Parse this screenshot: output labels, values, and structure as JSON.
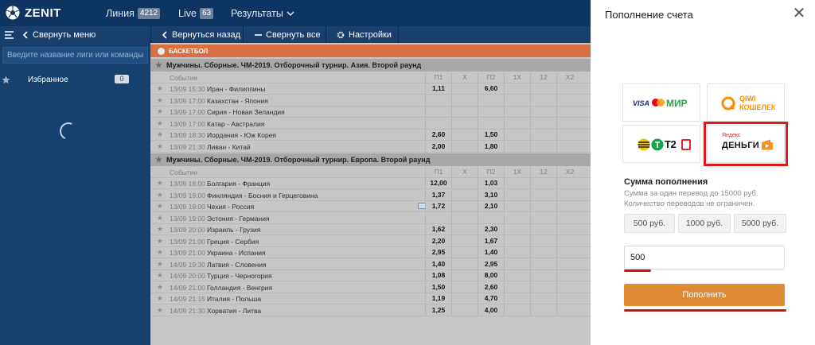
{
  "header": {
    "brand": "ZENIT",
    "nav": [
      {
        "label": "Линия",
        "badge": "4212"
      },
      {
        "label": "Live",
        "badge": "63"
      },
      {
        "label": "Результаты"
      }
    ]
  },
  "subbar": {
    "collapse_menu": "Свернуть меню",
    "back": "Вернуться назад",
    "collapse_all": "Свернуть все",
    "settings": "Настройки"
  },
  "sidebar": {
    "search_placeholder": "Введите название лиги или команды",
    "favorites_label": "Избранное",
    "favorites_count": "0"
  },
  "content": {
    "sport": "БАСКЕТБОЛ",
    "columns": [
      "Событие",
      "П1",
      "X",
      "П2",
      "1X",
      "12",
      "X2"
    ],
    "leagues": [
      {
        "title": "Мужчины. Сборные. ЧМ-2019. Отборочный турнир. Азия. Второй раунд",
        "events": [
          {
            "time": "13/09 15:30",
            "name": "Иран - Филиппины",
            "p1": "1,11",
            "p2": "6,60"
          },
          {
            "time": "13/09 17:00",
            "name": "Казахстан - Япония",
            "p1": "",
            "p2": ""
          },
          {
            "time": "13/09 17:00",
            "name": "Сирия - Новая Зеландия",
            "p1": "",
            "p2": ""
          },
          {
            "time": "13/09 17:00",
            "name": "Катар - Австралия",
            "p1": "",
            "p2": ""
          },
          {
            "time": "13/09 18:30",
            "name": "Иордания - Юж Корея",
            "p1": "2,60",
            "p2": "1,50"
          },
          {
            "time": "13/09 21:30",
            "name": "Ливан - Китай",
            "p1": "2,00",
            "p2": "1,80"
          }
        ]
      },
      {
        "title": "Мужчины. Сборные. ЧМ-2019. Отборочный турнир. Европа. Второй раунд",
        "events": [
          {
            "time": "13/09 18:00",
            "name": "Болгария - Франция",
            "p1": "12,00",
            "p2": "1,03"
          },
          {
            "time": "13/09 19:00",
            "name": "Финляндия - Босния и Герцеговина",
            "p1": "1,37",
            "p2": "3,10"
          },
          {
            "time": "13/09 19:00",
            "name": "Чехия - Россия",
            "p1": "1,72",
            "p2": "2,10"
          },
          {
            "time": "13/09 19:00",
            "name": "Эстония - Германия",
            "p1": "",
            "p2": ""
          },
          {
            "time": "13/09 20:00",
            "name": "Израиль - Грузия",
            "p1": "1,62",
            "p2": "2,30"
          },
          {
            "time": "13/09 21:00",
            "name": "Греция - Сербия",
            "p1": "2,20",
            "p2": "1,67"
          },
          {
            "time": "13/09 21:00",
            "name": "Украина - Испания",
            "p1": "2,95",
            "p2": "1,40"
          },
          {
            "time": "14/09 19:30",
            "name": "Латвия - Словения",
            "p1": "1,40",
            "p2": "2,95"
          },
          {
            "time": "14/09 20:00",
            "name": "Турция - Черногория",
            "p1": "1,08",
            "p2": "8,00"
          },
          {
            "time": "14/09 21:00",
            "name": "Голландия - Венгрия",
            "p1": "1,50",
            "p2": "2,60"
          },
          {
            "time": "14/09 21:15",
            "name": "Италия - Польша",
            "p1": "1,19",
            "p2": "4,70"
          },
          {
            "time": "14/09 21:30",
            "name": "Хорватия - Литва",
            "p1": "1,25",
            "p2": "4,00"
          }
        ]
      }
    ]
  },
  "deposit": {
    "title": "Пополнение счета",
    "payment_methods": [
      {
        "id": "cards",
        "text": "VISA · MasterCard · МИР"
      },
      {
        "id": "qiwi",
        "text": "QIWI КОШЕЛЕК",
        "line1": "QIWI",
        "line2": "КОШЕЛЕК"
      },
      {
        "id": "beeline-tele2",
        "text": "Билайн · Tele2",
        "brand": "T2"
      },
      {
        "id": "yandex",
        "text": "Яндекс Деньги",
        "line1": "Яндекс",
        "line2": "ДЕНЬГИ"
      }
    ],
    "amount_title": "Сумма пополнения",
    "amount_desc_1": "Сумма за один перевод до 15000 руб.",
    "amount_desc_2": "Количество переводов не ограничен.",
    "presets": [
      "500 руб.",
      "1000 руб.",
      "5000 руб."
    ],
    "amount_value": "500",
    "submit_label": "Пополнить",
    "colors": {
      "highlight": "#e01919",
      "submit": "#e28b36",
      "header": "#0d3564"
    }
  }
}
